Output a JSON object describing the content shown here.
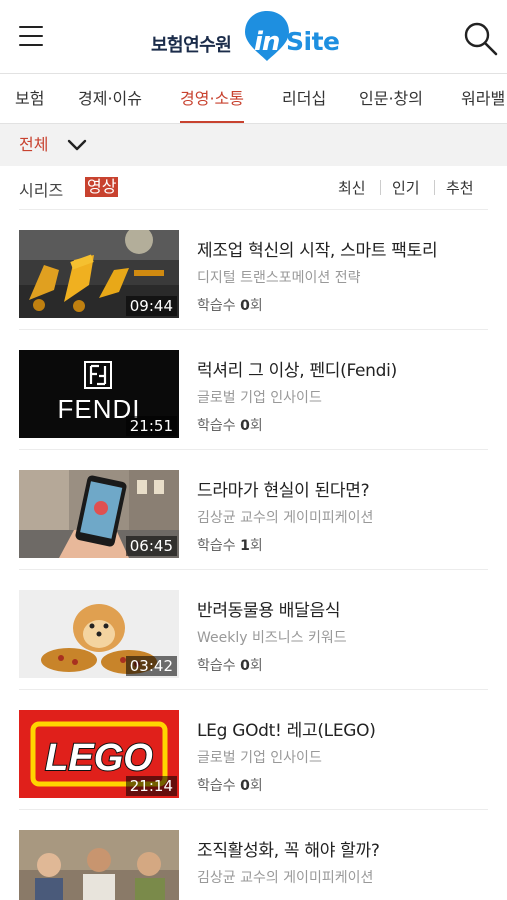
{
  "header": {
    "logo_kr": "보험연수원",
    "logo_in": "in",
    "logo_site": "Site"
  },
  "categories": [
    {
      "label": "보험"
    },
    {
      "label": "경제·이슈"
    },
    {
      "label": "경영·소통"
    },
    {
      "label": "리더십"
    },
    {
      "label": "인문·창의"
    },
    {
      "label": "워라밸"
    }
  ],
  "active_category": "경영·소통",
  "filter": {
    "label": "전체"
  },
  "tabs": {
    "series": "시리즈",
    "video": "영상"
  },
  "sort": {
    "latest": "최신",
    "popular": "인기",
    "recommended": "추천"
  },
  "count_prefix": "학습수",
  "count_suffix": "회",
  "videos": [
    {
      "title": "제조업 혁신의 시작, 스마트 팩토리",
      "subtitle": "디지털 트랜스포메이션 전략",
      "duration": "09:44",
      "count": "0"
    },
    {
      "title": "럭셔리 그 이상, 펜디(Fendi)",
      "subtitle": "글로벌 기업 인사이드",
      "duration": "21:51",
      "count": "0"
    },
    {
      "title": "드라마가 현실이 된다면?",
      "subtitle": "김상균 교수의 게이미피케이션",
      "duration": "06:45",
      "count": "1"
    },
    {
      "title": "반려동물용 배달음식",
      "subtitle": "Weekly 비즈니스 키워드",
      "duration": "03:42",
      "count": "0"
    },
    {
      "title": "LEg GOdt! 레고(LEGO)",
      "subtitle": "글로벌 기업 인사이드",
      "duration": "21:14",
      "count": "0"
    },
    {
      "title": "조직활성화, 꼭 해야 할까?",
      "subtitle": "김상균 교수의 게이미피케이션",
      "duration": "",
      "count": ""
    }
  ],
  "thumb_text": {
    "fendi": "FENDI",
    "lego": "LEGO"
  },
  "colors": {
    "accent": "#c8422f",
    "logo_blue": "#1e8fe0",
    "logo_navy": "#1b2c4a"
  }
}
